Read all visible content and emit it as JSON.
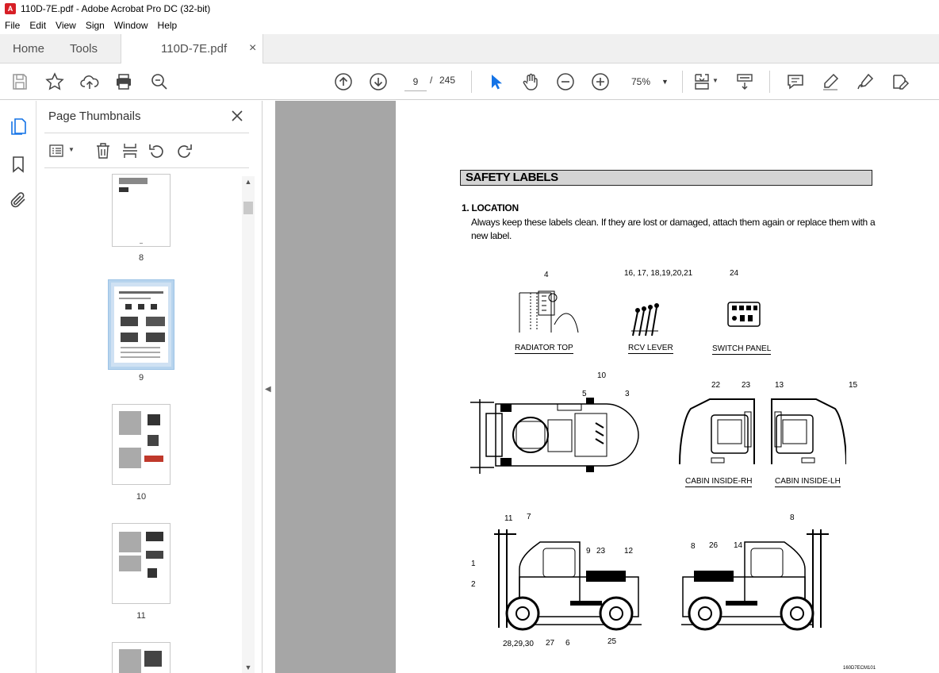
{
  "window": {
    "title": "110D-7E.pdf - Adobe Acrobat Pro DC (32-bit)"
  },
  "menu": [
    "File",
    "Edit",
    "View",
    "Sign",
    "Window",
    "Help"
  ],
  "tabs": {
    "home": "Home",
    "tools": "Tools",
    "doc": "110D-7E.pdf",
    "close": "×"
  },
  "toolbar": {
    "page_current": "9",
    "page_sep": "/",
    "page_total": "245",
    "zoom": "75%"
  },
  "thumbnails": {
    "title": "Page Thumbnails",
    "pages": [
      {
        "label": "8"
      },
      {
        "label": "9",
        "selected": true
      },
      {
        "label": "10"
      },
      {
        "label": "11"
      }
    ]
  },
  "document": {
    "section_title": "SAFETY LABELS",
    "location_heading": "1. LOCATION",
    "location_text": "Always keep these labels clean.  If they are lost or damaged, attach them again or replace them with a new label.",
    "captions": {
      "radiator_top": "RADIATOR TOP",
      "rcv_lever": "RCV LEVER",
      "switch_panel": "SWITCH PANEL",
      "cabin_rh": "CABIN INSIDE-RH",
      "cabin_lh": "CABIN INSIDE-LH"
    },
    "callouts": {
      "c4": "4",
      "c16_21": "16, 17, 18,19,20,21",
      "c24": "24",
      "c10": "10",
      "c5": "5",
      "c3": "3",
      "c22": "22",
      "c23a": "23",
      "c13": "13",
      "c15": "15",
      "c11": "11",
      "c7": "7",
      "c1": "1",
      "c2": "2",
      "c9": "9",
      "c23b": "23",
      "c12": "12",
      "c28": "28,29,30",
      "c27": "27",
      "c6": "6",
      "c25": "25",
      "c8a": "8",
      "c8b": "8",
      "c26": "26",
      "c14": "14"
    },
    "page_code": "160D7ECM101"
  }
}
